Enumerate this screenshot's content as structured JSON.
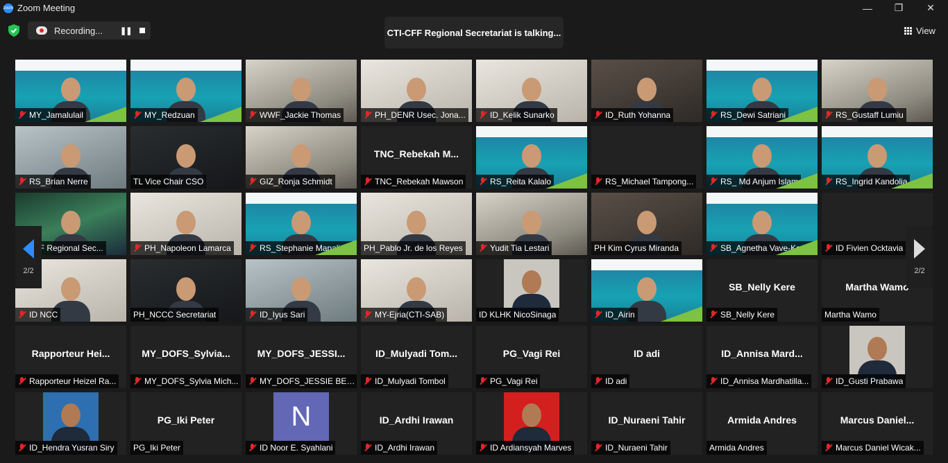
{
  "window": {
    "title": "Zoom Meeting",
    "minimize": "—",
    "maximize": "❐",
    "close": "✕"
  },
  "toolbar": {
    "recording_label": "Recording...",
    "pause_glyph": "❚❚",
    "talking": "CTI-CFF Regional Secretariat is talking...",
    "view_label": "View"
  },
  "pager": {
    "left": "2/2",
    "right": "2/2"
  },
  "participants": [
    {
      "name": "MY_Jamalulail",
      "big": "",
      "muted": true,
      "style": "slide"
    },
    {
      "name": "MY_Redzuan",
      "big": "",
      "muted": true,
      "style": "slide"
    },
    {
      "name": "WWF_Jackie Thomas",
      "big": "",
      "muted": true,
      "style": "room"
    },
    {
      "name": "PH_DENR Usec. Jona...",
      "big": "",
      "muted": true,
      "style": "bright"
    },
    {
      "name": "ID_Kelik Sunarko",
      "big": "",
      "muted": true,
      "style": "bright"
    },
    {
      "name": "ID_Ruth Yohanna",
      "big": "",
      "muted": true,
      "style": "warm"
    },
    {
      "name": "RS_Dewi Satriani",
      "big": "",
      "muted": true,
      "style": "slide"
    },
    {
      "name": "RS_Gustaff Lumiu",
      "big": "",
      "muted": true,
      "style": "room"
    },
    {
      "name": "RS_Brian Nerre",
      "big": "",
      "muted": true,
      "style": "cool"
    },
    {
      "name": "TL Vice Chair CSO",
      "big": "",
      "muted": false,
      "style": "dark"
    },
    {
      "name": "GIZ_Ronja Schmidt",
      "big": "",
      "muted": true,
      "style": "room"
    },
    {
      "name": "TNC_Rebekah Mawson",
      "big": "TNC_Rebekah  M...",
      "muted": true,
      "style": "blank"
    },
    {
      "name": "RS_Reita Kalalo",
      "big": "",
      "muted": true,
      "style": "slide"
    },
    {
      "name": "RS_Michael Tampong...",
      "big": "",
      "muted": true,
      "style": "blank"
    },
    {
      "name": "RS_ Md Anjum Islam",
      "big": "",
      "muted": true,
      "style": "slide"
    },
    {
      "name": "RS_Ingrid Kandolia",
      "big": "",
      "muted": true,
      "style": "slide"
    },
    {
      "name": "TI-CFF Regional Sec...",
      "big": "",
      "muted": false,
      "style": "aurora"
    },
    {
      "name": "PH_Napoleon Lamarca",
      "big": "",
      "muted": true,
      "style": "bright"
    },
    {
      "name": "RS_Stephanie Mapaliey",
      "big": "",
      "muted": true,
      "style": "slide"
    },
    {
      "name": "PH_Pablo Jr. de los Reyes",
      "big": "",
      "muted": false,
      "style": "bright"
    },
    {
      "name": "Yudit Tia Lestari",
      "big": "",
      "muted": true,
      "style": "room"
    },
    {
      "name": "PH Kim Cyrus Miranda",
      "big": "",
      "muted": false,
      "style": "warm"
    },
    {
      "name": "SB_Agnetha Vave-Kar...",
      "big": "",
      "muted": true,
      "style": "slide"
    },
    {
      "name": "ID Fivien Ocktavia",
      "big": "",
      "muted": true,
      "style": "blank"
    },
    {
      "name": "ID NCC",
      "big": "",
      "muted": true,
      "style": "bright"
    },
    {
      "name": "PH_NCCC Secretariat",
      "big": "",
      "muted": false,
      "style": "dark"
    },
    {
      "name": "ID_Iyus Sari",
      "big": "",
      "muted": true,
      "style": "cool"
    },
    {
      "name": "MY-Ejria(CTI-SAB)",
      "big": "",
      "muted": true,
      "style": "bright"
    },
    {
      "name": "ID KLHK  NicoSinaga",
      "big": "",
      "muted": false,
      "style": "blank",
      "photo": "grey"
    },
    {
      "name": "ID_Airin",
      "big": "",
      "muted": true,
      "style": "slide"
    },
    {
      "name": "SB_Nelly Kere",
      "big": "SB_Nelly Kere",
      "muted": true,
      "style": "blank"
    },
    {
      "name": "Martha Wamo",
      "big": "Martha Wamo",
      "muted": false,
      "style": "blank"
    },
    {
      "name": "Rapporteur Heizel Ra...",
      "big": "Rapporteur  Hei...",
      "muted": true,
      "style": "blank"
    },
    {
      "name": "MY_DOFS_Sylvia Mich...",
      "big": "MY_DOFS_Sylvia...",
      "muted": true,
      "style": "blank"
    },
    {
      "name": "MY_DOFS_JESSIE BELI...",
      "big": "MY_DOFS_JESSI...",
      "muted": true,
      "style": "blank"
    },
    {
      "name": "ID_Mulyadi Tombol",
      "big": "ID_Mulyadi  Tom...",
      "muted": true,
      "style": "blank"
    },
    {
      "name": "PG_Vagi Rei",
      "big": "PG_Vagi Rei",
      "muted": true,
      "style": "blank"
    },
    {
      "name": "ID adi",
      "big": "ID adi",
      "muted": true,
      "style": "blank"
    },
    {
      "name": "ID_Annisa Mardhatilla...",
      "big": "ID_Annisa  Mard...",
      "muted": true,
      "style": "blank"
    },
    {
      "name": "ID_Gusti Prabawa",
      "big": "",
      "muted": true,
      "style": "blank",
      "photo": "grey"
    },
    {
      "name": "ID_Hendra Yusran Siry",
      "big": "",
      "muted": true,
      "style": "blank",
      "photo": "blue"
    },
    {
      "name": "PG_Iki Peter",
      "big": "PG_Iki Peter",
      "muted": false,
      "style": "blank"
    },
    {
      "name": "ID Noor E. Syahlani",
      "big": "",
      "muted": true,
      "style": "blank",
      "photo": "N"
    },
    {
      "name": "ID_Ardhi Irawan",
      "big": "ID_Ardhi Irawan",
      "muted": true,
      "style": "blank"
    },
    {
      "name": "ID Ardiansyah Marves",
      "big": "",
      "muted": true,
      "style": "blank",
      "photo": "red"
    },
    {
      "name": "ID_Nuraeni Tahir",
      "big": "ID_Nuraeni Tahir",
      "muted": true,
      "style": "blank"
    },
    {
      "name": "Armida Andres",
      "big": "Armida Andres",
      "muted": false,
      "style": "blank"
    },
    {
      "name": "Marcus Daniel Wicak...",
      "big": "Marcus  Daniel...",
      "muted": true,
      "style": "blank"
    }
  ],
  "colors": {
    "accent": "#2d8cff",
    "muted": "#e02828",
    "shield": "#23c552"
  }
}
